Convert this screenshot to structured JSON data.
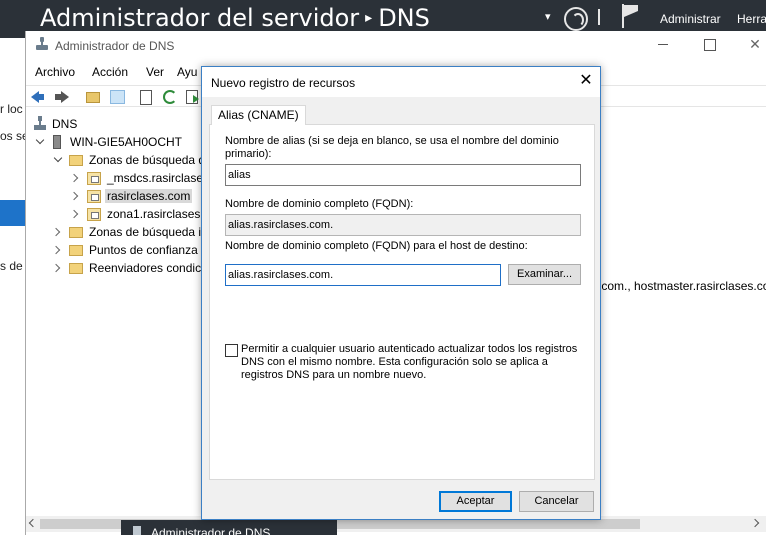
{
  "server_manager": {
    "title": "Administrador del servidor",
    "breadcrumb_sep": "▸",
    "section": "DNS",
    "dropdown_icon": "▾",
    "menu_admin": "Administrar",
    "menu_tools": "Herra",
    "left_fragments": [
      "r loc",
      "os se",
      "s de"
    ]
  },
  "dns_window": {
    "title": "Administrador de DNS",
    "close_glyph": "✕",
    "menu": [
      "Archivo",
      "Acción",
      "Ver",
      "Ayu"
    ],
    "tree": {
      "root": "DNS",
      "server": "WIN-GIE5AH0OCHT",
      "forward_zones": "Zonas de búsqueda d",
      "zone_msdcs": "_msdcs.rasirclases",
      "zone_selected": "rasirclases.com",
      "zone_1": "zona1.rasirclases.c",
      "reverse_zones": "Zonas de búsqueda in",
      "trust_points": "Puntos de confianza",
      "forwarders": "Reenviadores condici"
    },
    "right_text": [
      ".com., hostmaster.rasirclases.co",
      "."
    ]
  },
  "taskbar": {
    "label": "Administrador de DNS"
  },
  "dialog": {
    "title": "Nuevo registro de recursos",
    "close_glyph": "✕",
    "tab": "Alias (CNAME)",
    "alias_label": "Nombre de alias (si se deja en blanco, se usa el nombre del dominio primario):",
    "alias_value": "alias",
    "fqdn_label": "Nombre de dominio completo (FQDN):",
    "fqdn_value": "alias.rasirclases.com.",
    "target_label": "Nombre de dominio completo (FQDN) para el host de destino:",
    "target_value": "alias.rasirclases.com.",
    "browse_button": "Examinar...",
    "checkbox_label": "Permitir a cualquier usuario autenticado actualizar todos los registros DNS con el mismo nombre. Esta configuración solo se aplica a registros DNS para un nombre nuevo.",
    "checkbox_checked": false,
    "ok_button": "Aceptar",
    "cancel_button": "Cancelar"
  },
  "colors": {
    "header_bg": "#2b3138",
    "accent": "#0078d7",
    "selection_blue": "#1e73c9"
  }
}
